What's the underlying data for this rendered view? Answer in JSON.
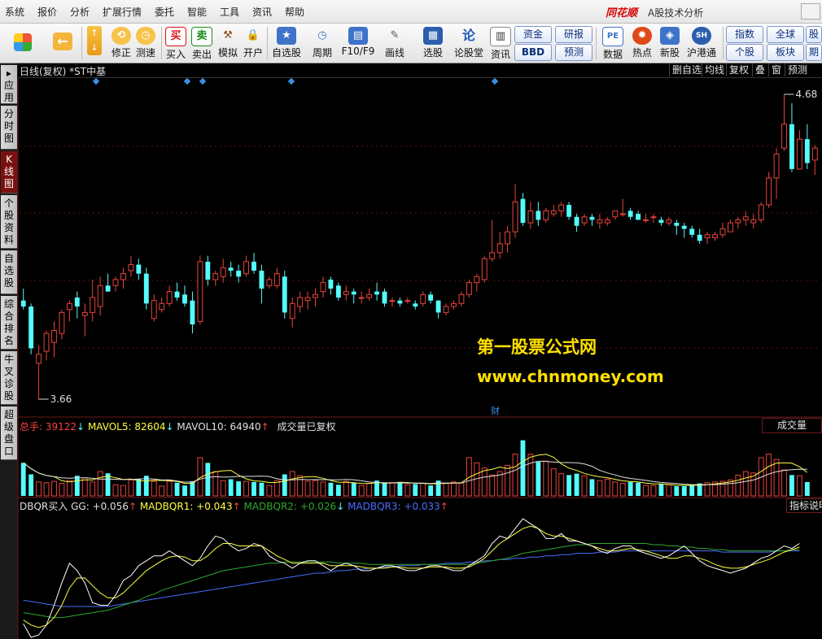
{
  "menu": {
    "items": [
      "系统",
      "报价",
      "分析",
      "扩展行情",
      "委托",
      "智能",
      "工具",
      "资讯",
      "帮助"
    ],
    "brand": "同花顺",
    "app_title": "A股技术分析"
  },
  "toolbar": {
    "buttons": [
      {
        "label": "修正",
        "icon": "arrow-up-down-icon"
      },
      {
        "label": "测速",
        "icon": "clock-icon"
      },
      {
        "label": "买入",
        "icon": "buy-icon",
        "glyph": "买"
      },
      {
        "label": "卖出",
        "icon": "sell-icon",
        "glyph": "卖"
      },
      {
        "label": "模拟",
        "icon": "hammer-icon"
      },
      {
        "label": "开户",
        "icon": "lock-icon"
      },
      {
        "label": "自选股",
        "icon": "star-icon"
      },
      {
        "label": "周期",
        "icon": "clock-icon"
      },
      {
        "label": "F10/F9",
        "icon": "report-icon"
      },
      {
        "label": "画线",
        "icon": "pen-icon"
      },
      {
        "label": "选股",
        "icon": "screen-icon"
      },
      {
        "label": "论股堂",
        "icon": "forum-icon",
        "glyph": "论"
      },
      {
        "label": "资讯",
        "icon": "news-icon"
      },
      {
        "label": "数据",
        "icon": "pe-icon",
        "glyph": "PE"
      },
      {
        "label": "热点",
        "icon": "hot-icon"
      },
      {
        "label": "新股",
        "icon": "ipo-icon"
      },
      {
        "label": "沪港通",
        "icon": "hk-icon"
      }
    ],
    "small_buttons": [
      "资金",
      "BBD",
      "研报",
      "预测",
      "指数",
      "个股",
      "全球",
      "板块",
      "股",
      "期"
    ]
  },
  "side_tabs": [
    {
      "label": "应用"
    },
    {
      "label": "分时图"
    },
    {
      "label": "K线图",
      "active": true
    },
    {
      "label": "个股资料"
    },
    {
      "label": "自选股"
    },
    {
      "label": "综合排名"
    },
    {
      "label": "牛叉诊股"
    },
    {
      "label": "超级盘口"
    }
  ],
  "chart_header": {
    "title": "日线(复权) *ST中基",
    "buttons": [
      "删自选",
      "均线",
      "复权",
      "叠",
      "窗",
      "预测"
    ]
  },
  "watermark": {
    "line1": "第一股票公式网",
    "line2": "www.chnmoney.com"
  },
  "volume_panel": {
    "legend": [
      {
        "text": "总手: 39122",
        "arrow": "↓",
        "color": "#ff4040"
      },
      {
        "text": "MAVOL5: 82604",
        "arrow": "↓",
        "color": "#ffff40"
      },
      {
        "text": "MAVOL10: 64940",
        "arrow": "↑",
        "color": "#e0e0e0"
      },
      {
        "text": "成交量已复权",
        "arrow": "",
        "color": "#e0e0e0"
      }
    ],
    "button": "成交量"
  },
  "indicator_panel": {
    "legend": [
      {
        "text": "DBQR买入",
        "arrow": "",
        "color": "#e0e0e0"
      },
      {
        "text": "GG: +0.056",
        "arrow": "↑",
        "color": "#e0e0e0"
      },
      {
        "text": "MADBQR1: +0.043",
        "arrow": "↑",
        "color": "#ffff40"
      },
      {
        "text": "MADBQR2: +0.026",
        "arrow": "↓",
        "color": "#2fa82f"
      },
      {
        "text": "MADBQR3: +0.033",
        "arrow": "↑",
        "color": "#4a6cff"
      }
    ],
    "button": "指标说明"
  },
  "colors": {
    "up": "#e8443a",
    "down": "#54fcfc",
    "ma5": "#ffff40",
    "gg": "#ffffff",
    "madbqr2": "#2fa82f",
    "madbqr3": "#4a6cff"
  },
  "chart_data": {
    "type": "candlestick",
    "high_label": "4.68",
    "low_label": "3.66",
    "event_marker": "财",
    "candles": [
      {
        "o": 3.99,
        "h": 4.03,
        "l": 3.96,
        "c": 3.97
      },
      {
        "o": 3.97,
        "h": 3.98,
        "l": 3.81,
        "c": 3.83
      },
      {
        "o": 3.78,
        "h": 3.84,
        "l": 3.66,
        "c": 3.81
      },
      {
        "o": 3.82,
        "h": 3.89,
        "l": 3.79,
        "c": 3.88
      },
      {
        "o": 3.85,
        "h": 3.92,
        "l": 3.8,
        "c": 3.89
      },
      {
        "o": 3.88,
        "h": 3.96,
        "l": 3.86,
        "c": 3.95
      },
      {
        "o": 3.96,
        "h": 3.99,
        "l": 3.92,
        "c": 3.98
      },
      {
        "o": 4.0,
        "h": 4.02,
        "l": 3.93,
        "c": 3.97
      },
      {
        "o": 3.94,
        "h": 3.98,
        "l": 3.87,
        "c": 3.95
      },
      {
        "o": 3.95,
        "h": 4.06,
        "l": 3.92,
        "c": 4.0
      },
      {
        "o": 3.97,
        "h": 4.07,
        "l": 3.94,
        "c": 4.04
      },
      {
        "o": 4.04,
        "h": 4.08,
        "l": 4.02,
        "c": 4.02
      },
      {
        "o": 4.04,
        "h": 4.07,
        "l": 4.02,
        "c": 4.06
      },
      {
        "o": 4.06,
        "h": 4.1,
        "l": 4.03,
        "c": 4.08
      },
      {
        "o": 4.09,
        "h": 4.14,
        "l": 4.07,
        "c": 4.11
      },
      {
        "o": 4.11,
        "h": 4.13,
        "l": 4.06,
        "c": 4.08
      },
      {
        "o": 4.08,
        "h": 4.1,
        "l": 3.96,
        "c": 3.98
      },
      {
        "o": 3.93,
        "h": 4.01,
        "l": 3.92,
        "c": 3.99
      },
      {
        "o": 3.96,
        "h": 4.0,
        "l": 3.95,
        "c": 3.98
      },
      {
        "o": 3.98,
        "h": 4.04,
        "l": 3.97,
        "c": 4.02
      },
      {
        "o": 4.02,
        "h": 4.05,
        "l": 3.99,
        "c": 4.0
      },
      {
        "o": 4.01,
        "h": 4.04,
        "l": 3.97,
        "c": 3.98
      },
      {
        "o": 3.99,
        "h": 4.02,
        "l": 3.88,
        "c": 3.91
      },
      {
        "o": 3.92,
        "h": 4.14,
        "l": 3.91,
        "c": 4.12
      },
      {
        "o": 4.12,
        "h": 4.14,
        "l": 4.04,
        "c": 4.06
      },
      {
        "o": 4.06,
        "h": 4.09,
        "l": 4.04,
        "c": 4.08
      },
      {
        "o": 4.07,
        "h": 4.13,
        "l": 4.05,
        "c": 4.1
      },
      {
        "o": 4.1,
        "h": 4.12,
        "l": 4.07,
        "c": 4.09
      },
      {
        "o": 4.09,
        "h": 4.11,
        "l": 4.05,
        "c": 4.07
      },
      {
        "o": 4.08,
        "h": 4.14,
        "l": 4.07,
        "c": 4.12
      },
      {
        "o": 4.12,
        "h": 4.15,
        "l": 4.08,
        "c": 4.09
      },
      {
        "o": 4.09,
        "h": 4.11,
        "l": 3.98,
        "c": 4.03
      },
      {
        "o": 4.04,
        "h": 4.07,
        "l": 4.03,
        "c": 4.06
      },
      {
        "o": 4.04,
        "h": 4.1,
        "l": 4.03,
        "c": 4.08
      },
      {
        "o": 4.07,
        "h": 4.09,
        "l": 3.93,
        "c": 3.95
      },
      {
        "o": 3.93,
        "h": 4.0,
        "l": 3.9,
        "c": 3.98
      },
      {
        "o": 3.97,
        "h": 4.02,
        "l": 3.95,
        "c": 4.0
      },
      {
        "o": 3.99,
        "h": 4.02,
        "l": 3.96,
        "c": 4.0
      },
      {
        "o": 4.0,
        "h": 4.03,
        "l": 3.97,
        "c": 4.01
      },
      {
        "o": 4.02,
        "h": 4.07,
        "l": 4.0,
        "c": 4.05
      },
      {
        "o": 4.06,
        "h": 4.07,
        "l": 4.01,
        "c": 4.03
      },
      {
        "o": 4.04,
        "h": 4.05,
        "l": 3.99,
        "c": 4.0
      },
      {
        "o": 4.01,
        "h": 4.04,
        "l": 3.99,
        "c": 4.02
      },
      {
        "o": 4.02,
        "h": 4.03,
        "l": 3.98,
        "c": 4.01
      },
      {
        "o": 4.0,
        "h": 4.02,
        "l": 3.98,
        "c": 4.0
      },
      {
        "o": 4.0,
        "h": 4.03,
        "l": 3.99,
        "c": 4.01
      },
      {
        "o": 4.02,
        "h": 4.05,
        "l": 3.99,
        "c": 4.01
      },
      {
        "o": 4.02,
        "h": 4.03,
        "l": 3.97,
        "c": 3.98
      },
      {
        "o": 3.99,
        "h": 4.0,
        "l": 3.97,
        "c": 3.99
      },
      {
        "o": 3.99,
        "h": 4.0,
        "l": 3.97,
        "c": 3.98
      },
      {
        "o": 3.99,
        "h": 4.0,
        "l": 3.98,
        "c": 3.99
      },
      {
        "o": 3.98,
        "h": 3.99,
        "l": 3.96,
        "c": 3.97
      },
      {
        "o": 3.98,
        "h": 4.02,
        "l": 3.97,
        "c": 4.01
      },
      {
        "o": 4.01,
        "h": 4.02,
        "l": 3.98,
        "c": 3.99
      },
      {
        "o": 3.99,
        "h": 3.99,
        "l": 3.93,
        "c": 3.95
      },
      {
        "o": 3.95,
        "h": 3.98,
        "l": 3.94,
        "c": 3.97
      },
      {
        "o": 3.97,
        "h": 3.99,
        "l": 3.96,
        "c": 3.98
      },
      {
        "o": 3.98,
        "h": 4.02,
        "l": 3.97,
        "c": 4.01
      },
      {
        "o": 4.01,
        "h": 4.06,
        "l": 4.0,
        "c": 4.05
      },
      {
        "o": 4.05,
        "h": 4.08,
        "l": 4.02,
        "c": 4.07
      },
      {
        "o": 4.06,
        "h": 4.14,
        "l": 4.05,
        "c": 4.13
      },
      {
        "o": 4.13,
        "h": 4.26,
        "l": 4.12,
        "c": 4.15
      },
      {
        "o": 4.15,
        "h": 4.22,
        "l": 4.13,
        "c": 4.18
      },
      {
        "o": 4.18,
        "h": 4.24,
        "l": 4.15,
        "c": 4.22
      },
      {
        "o": 4.22,
        "h": 4.38,
        "l": 4.2,
        "c": 4.32
      },
      {
        "o": 4.33,
        "h": 4.35,
        "l": 4.24,
        "c": 4.25
      },
      {
        "o": 4.25,
        "h": 4.32,
        "l": 4.23,
        "c": 4.29
      },
      {
        "o": 4.29,
        "h": 4.32,
        "l": 4.24,
        "c": 4.26
      },
      {
        "o": 4.26,
        "h": 4.3,
        "l": 4.25,
        "c": 4.29
      },
      {
        "o": 4.28,
        "h": 4.31,
        "l": 4.27,
        "c": 4.29
      },
      {
        "o": 4.29,
        "h": 4.32,
        "l": 4.27,
        "c": 4.31
      },
      {
        "o": 4.31,
        "h": 4.32,
        "l": 4.26,
        "c": 4.27
      },
      {
        "o": 4.27,
        "h": 4.28,
        "l": 4.22,
        "c": 4.24
      },
      {
        "o": 4.25,
        "h": 4.28,
        "l": 4.24,
        "c": 4.27
      },
      {
        "o": 4.27,
        "h": 4.28,
        "l": 4.24,
        "c": 4.26
      },
      {
        "o": 4.25,
        "h": 4.28,
        "l": 4.23,
        "c": 4.26
      },
      {
        "o": 4.25,
        "h": 4.27,
        "l": 4.24,
        "c": 4.26
      },
      {
        "o": 4.27,
        "h": 4.29,
        "l": 4.26,
        "c": 4.29
      },
      {
        "o": 4.28,
        "h": 4.33,
        "l": 4.27,
        "c": 4.28
      },
      {
        "o": 4.29,
        "h": 4.3,
        "l": 4.26,
        "c": 4.27
      },
      {
        "o": 4.28,
        "h": 4.29,
        "l": 4.26,
        "c": 4.26
      },
      {
        "o": 4.26,
        "h": 4.28,
        "l": 4.25,
        "c": 4.26
      },
      {
        "o": 4.27,
        "h": 4.28,
        "l": 4.25,
        "c": 4.27
      },
      {
        "o": 4.26,
        "h": 4.27,
        "l": 4.24,
        "c": 4.25
      },
      {
        "o": 4.25,
        "h": 4.27,
        "l": 4.24,
        "c": 4.26
      },
      {
        "o": 4.25,
        "h": 4.26,
        "l": 4.21,
        "c": 4.24
      },
      {
        "o": 4.24,
        "h": 4.25,
        "l": 4.2,
        "c": 4.23
      },
      {
        "o": 4.23,
        "h": 4.24,
        "l": 4.2,
        "c": 4.21
      },
      {
        "o": 4.21,
        "h": 4.23,
        "l": 4.18,
        "c": 4.19
      },
      {
        "o": 4.2,
        "h": 4.22,
        "l": 4.18,
        "c": 4.21
      },
      {
        "o": 4.2,
        "h": 4.22,
        "l": 4.19,
        "c": 4.21
      },
      {
        "o": 4.21,
        "h": 4.25,
        "l": 4.2,
        "c": 4.23
      },
      {
        "o": 4.22,
        "h": 4.26,
        "l": 4.22,
        "c": 4.25
      },
      {
        "o": 4.25,
        "h": 4.27,
        "l": 4.23,
        "c": 4.26
      },
      {
        "o": 4.26,
        "h": 4.29,
        "l": 4.24,
        "c": 4.27
      },
      {
        "o": 4.25,
        "h": 4.28,
        "l": 4.23,
        "c": 4.26
      },
      {
        "o": 4.26,
        "h": 4.32,
        "l": 4.25,
        "c": 4.31
      },
      {
        "o": 4.31,
        "h": 4.42,
        "l": 4.3,
        "c": 4.4
      },
      {
        "o": 4.4,
        "h": 4.5,
        "l": 4.33,
        "c": 4.48
      },
      {
        "o": 4.5,
        "h": 4.68,
        "l": 4.49,
        "c": 4.58
      },
      {
        "o": 4.58,
        "h": 4.65,
        "l": 4.42,
        "c": 4.43
      },
      {
        "o": 4.43,
        "h": 4.56,
        "l": 4.43,
        "c": 4.53
      },
      {
        "o": 4.53,
        "h": 4.58,
        "l": 4.43,
        "c": 4.45
      },
      {
        "o": 4.46,
        "h": 4.51,
        "l": 4.41,
        "c": 4.5
      }
    ],
    "volume": [
      95,
      62,
      40,
      38,
      42,
      36,
      44,
      58,
      52,
      40,
      70,
      65,
      32,
      30,
      46,
      48,
      58,
      42,
      28,
      42,
      38,
      30,
      42,
      110,
      95,
      70,
      44,
      48,
      42,
      42,
      40,
      38,
      30,
      44,
      62,
      70,
      58,
      42,
      44,
      40,
      38,
      32,
      42,
      38,
      30,
      36,
      44,
      38,
      38,
      40,
      32,
      34,
      36,
      30,
      44,
      36,
      40,
      38,
      110,
      95,
      80,
      60,
      70,
      88,
      120,
      160,
      120,
      98,
      100,
      78,
      64,
      60,
      64,
      58,
      48,
      44,
      48,
      40,
      36,
      40,
      38,
      30,
      30,
      34,
      32,
      28,
      28,
      30,
      36,
      38,
      40,
      42,
      46,
      60,
      70,
      66,
      110,
      120,
      105,
      75,
      60,
      58,
      40
    ],
    "volume_ylim": [
      0,
      180
    ],
    "gg": [
      0.11,
      0.0,
      0.02,
      0.1,
      0.26,
      0.44,
      0.6,
      0.54,
      0.44,
      0.28,
      0.26,
      0.26,
      0.34,
      0.46,
      0.5,
      0.58,
      0.62,
      0.66,
      0.66,
      0.7,
      0.66,
      0.62,
      0.58,
      0.64,
      0.74,
      0.82,
      0.8,
      0.74,
      0.7,
      0.72,
      0.76,
      0.74,
      0.66,
      0.62,
      0.6,
      0.56,
      0.6,
      0.62,
      0.62,
      0.58,
      0.54,
      0.58,
      0.6,
      0.58,
      0.54,
      0.54,
      0.56,
      0.58,
      0.58,
      0.56,
      0.54,
      0.54,
      0.56,
      0.58,
      0.58,
      0.56,
      0.54,
      0.54,
      0.58,
      0.62,
      0.66,
      0.76,
      0.82,
      0.8,
      0.88,
      0.96,
      0.92,
      0.88,
      0.8,
      0.8,
      0.84,
      0.78,
      0.78,
      0.76,
      0.74,
      0.7,
      0.68,
      0.72,
      0.74,
      0.74,
      0.7,
      0.68,
      0.66,
      0.64,
      0.66,
      0.7,
      0.74,
      0.68,
      0.62,
      0.58,
      0.56,
      0.54,
      0.52,
      0.54,
      0.56,
      0.6,
      0.64,
      0.66,
      0.7,
      0.74,
      0.72,
      0.76
    ],
    "madbqr1": [
      0.14,
      0.1,
      0.08,
      0.1,
      0.16,
      0.26,
      0.4,
      0.48,
      0.48,
      0.42,
      0.36,
      0.32,
      0.32,
      0.36,
      0.42,
      0.48,
      0.54,
      0.58,
      0.62,
      0.65,
      0.66,
      0.65,
      0.62,
      0.62,
      0.66,
      0.72,
      0.76,
      0.76,
      0.74,
      0.74,
      0.74,
      0.74,
      0.7,
      0.66,
      0.63,
      0.6,
      0.6,
      0.6,
      0.6,
      0.6,
      0.58,
      0.58,
      0.58,
      0.58,
      0.57,
      0.56,
      0.56,
      0.56,
      0.57,
      0.57,
      0.56,
      0.56,
      0.56,
      0.57,
      0.57,
      0.57,
      0.56,
      0.56,
      0.57,
      0.6,
      0.64,
      0.7,
      0.76,
      0.8,
      0.84,
      0.88,
      0.9,
      0.88,
      0.84,
      0.82,
      0.82,
      0.8,
      0.78,
      0.76,
      0.74,
      0.72,
      0.7,
      0.7,
      0.71,
      0.72,
      0.71,
      0.7,
      0.68,
      0.66,
      0.64,
      0.64,
      0.66,
      0.66,
      0.64,
      0.62,
      0.59,
      0.57,
      0.56,
      0.56,
      0.57,
      0.59,
      0.61,
      0.63,
      0.66,
      0.69,
      0.71,
      0.73
    ],
    "madbqr2": [
      0.2,
      0.19,
      0.18,
      0.17,
      0.16,
      0.16,
      0.17,
      0.18,
      0.19,
      0.2,
      0.21,
      0.22,
      0.24,
      0.26,
      0.28,
      0.3,
      0.33,
      0.35,
      0.38,
      0.4,
      0.42,
      0.44,
      0.46,
      0.48,
      0.5,
      0.52,
      0.54,
      0.55,
      0.56,
      0.57,
      0.58,
      0.59,
      0.6,
      0.6,
      0.61,
      0.61,
      0.61,
      0.61,
      0.61,
      0.61,
      0.61,
      0.6,
      0.6,
      0.6,
      0.6,
      0.59,
      0.59,
      0.59,
      0.59,
      0.59,
      0.59,
      0.59,
      0.59,
      0.59,
      0.59,
      0.59,
      0.59,
      0.59,
      0.59,
      0.6,
      0.61,
      0.62,
      0.63,
      0.64,
      0.66,
      0.68,
      0.69,
      0.7,
      0.71,
      0.72,
      0.73,
      0.74,
      0.75,
      0.75,
      0.76,
      0.76,
      0.76,
      0.76,
      0.76,
      0.76,
      0.76,
      0.76,
      0.75,
      0.75,
      0.74,
      0.74,
      0.73,
      0.73,
      0.72,
      0.72,
      0.71,
      0.71,
      0.7,
      0.7,
      0.7,
      0.7,
      0.7,
      0.7,
      0.7,
      0.7,
      0.71,
      0.71
    ],
    "madbqr3": [
      0.3,
      0.29,
      0.28,
      0.27,
      0.26,
      0.25,
      0.25,
      0.25,
      0.25,
      0.25,
      0.25,
      0.25,
      0.26,
      0.27,
      0.28,
      0.29,
      0.3,
      0.31,
      0.32,
      0.33,
      0.34,
      0.35,
      0.36,
      0.37,
      0.38,
      0.39,
      0.4,
      0.41,
      0.42,
      0.43,
      0.44,
      0.45,
      0.46,
      0.47,
      0.48,
      0.49,
      0.5,
      0.51,
      0.52,
      0.52,
      0.53,
      0.54,
      0.54,
      0.55,
      0.55,
      0.56,
      0.56,
      0.57,
      0.57,
      0.58,
      0.58,
      0.58,
      0.59,
      0.59,
      0.59,
      0.6,
      0.6,
      0.6,
      0.61,
      0.61,
      0.62,
      0.62,
      0.63,
      0.63,
      0.64,
      0.64,
      0.65,
      0.65,
      0.66,
      0.66,
      0.67,
      0.67,
      0.68,
      0.68,
      0.68,
      0.69,
      0.69,
      0.69,
      0.7,
      0.7,
      0.7,
      0.7,
      0.7,
      0.7,
      0.7,
      0.7,
      0.7,
      0.7,
      0.7,
      0.7,
      0.7,
      0.69,
      0.69,
      0.69,
      0.69,
      0.69,
      0.69,
      0.69,
      0.7,
      0.7,
      0.7,
      0.7
    ],
    "indicator_ylim": [
      0,
      1
    ]
  }
}
